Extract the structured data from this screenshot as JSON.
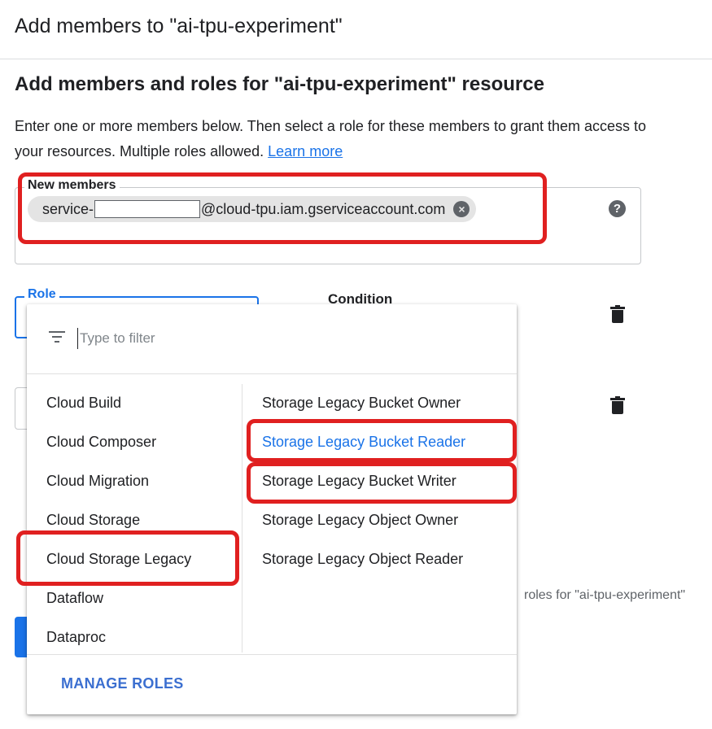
{
  "header": {
    "title": "Add members to \"ai-tpu-experiment\""
  },
  "section": {
    "title": "Add members and roles for \"ai-tpu-experiment\" resource",
    "description": "Enter one or more members below. Then select a role for these members to grant them access to your resources. Multiple roles allowed.",
    "learn_more": "Learn more"
  },
  "members": {
    "label": "New members",
    "chip_prefix": "service-",
    "chip_suffix": "@cloud-tpu.iam.gserviceaccount.com",
    "help_glyph": "?"
  },
  "role": {
    "label": "Role"
  },
  "condition": {
    "label": "Condition"
  },
  "footer_text": "roles for \"ai-tpu-experiment\"",
  "dropdown": {
    "filter_placeholder": "Type to filter",
    "categories": [
      "Cloud Build",
      "Cloud Composer",
      "Cloud Migration",
      "Cloud Storage",
      "Cloud Storage Legacy",
      "Dataflow",
      "Dataproc"
    ],
    "selected_category": "Cloud Storage Legacy",
    "roles": [
      "Storage Legacy Bucket Owner",
      "Storage Legacy Bucket Reader",
      "Storage Legacy Bucket Writer",
      "Storage Legacy Object Owner",
      "Storage Legacy Object Reader"
    ],
    "active_role": "Storage Legacy Bucket Reader",
    "manage_roles": "MANAGE ROLES"
  },
  "colors": {
    "accent": "#1a73e8",
    "highlight": "#e02020",
    "text": "#202124"
  },
  "icons": [
    "filter-icon",
    "help-icon",
    "close-icon",
    "trash-icon"
  ]
}
